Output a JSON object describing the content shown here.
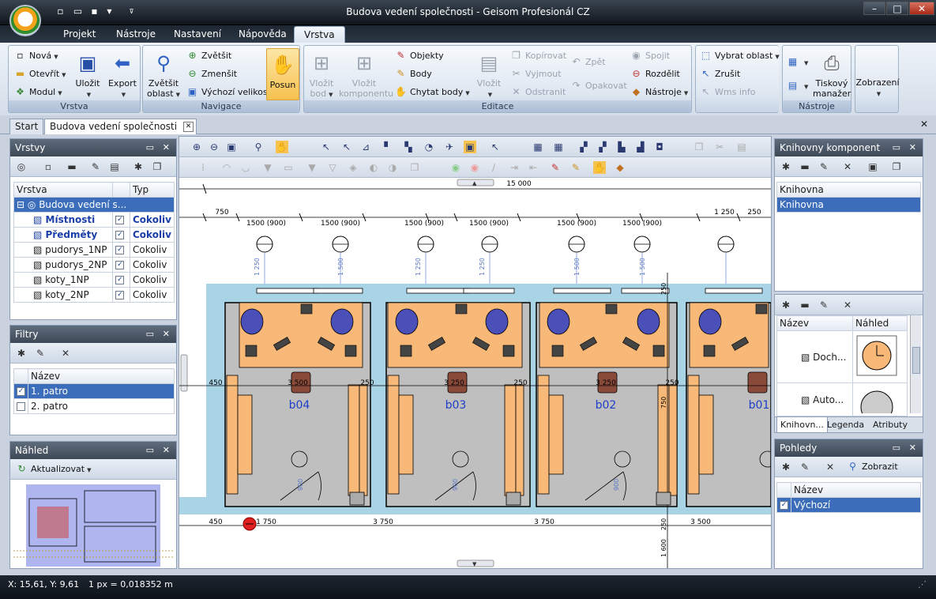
{
  "window": {
    "title": "Budova vedení společnosti - Geisom Profesionál CZ"
  },
  "ribbon_tabs": [
    "Projekt",
    "Nástroje",
    "Nastavení",
    "Nápověda",
    "Vrstva"
  ],
  "ribbon": {
    "vrstva_group": {
      "label": "Vrstva",
      "nova": "Nová",
      "otevrit": "Otevřít",
      "modul": "Modul",
      "ulozit": "Uložit",
      "export": "Export"
    },
    "navigace_group": {
      "label": "Navigace",
      "zvetsit_oblast_1": "Zvětšit",
      "zvetsit_oblast_2": "oblast",
      "zvetsit": "Zvětšit",
      "zmensit": "Zmenšit",
      "vychozi": "Výchozí velikost",
      "posun": "Posun"
    },
    "editace_group": {
      "label": "Editace",
      "vlozit_bod_1": "Vložit",
      "vlozit_bod_2": "bod",
      "vlozit_komp_1": "Vložit",
      "vlozit_komp_2": "komponentu",
      "objekty": "Objekty",
      "body": "Body",
      "chytat_body": "Chytat body",
      "vlozit": "Vložit",
      "kopirovat": "Kopírovat",
      "vyjmout": "Vyjmout",
      "odstranit": "Odstranit",
      "zpet": "Zpět",
      "opakovat": "Opakovat",
      "spojit": "Spojit",
      "rozdelit": "Rozdělit",
      "nastroje": "Nástroje",
      "vybrat_oblast": "Vybrat oblast",
      "zrusit": "Zrušit",
      "wms_info": "Wms info"
    },
    "nastroje_group": {
      "label": "Nástroje",
      "tiskovy_1": "Tiskový",
      "tiskovy_2": "manažer",
      "zobrazeni": "Zobrazení"
    }
  },
  "doc_tabs": {
    "start": "Start",
    "active": "Budova vedení společnosti"
  },
  "vrstvy": {
    "title": "Vrstvy",
    "col_vrstva": "Vrstva",
    "col_typ": "Typ",
    "root": "Budova vedení s...",
    "rows": [
      {
        "name": "Místnosti",
        "typ": "Cokoliv",
        "checked": "✓",
        "bold": true
      },
      {
        "name": "Předměty",
        "typ": "Cokoliv",
        "checked": "✓",
        "bold": true
      },
      {
        "name": "pudorys_1NP",
        "typ": "Cokoliv",
        "checked": "✓",
        "bold": false
      },
      {
        "name": "pudorys_2NP",
        "typ": "Cokoliv",
        "checked": "✓",
        "bold": false
      },
      {
        "name": "koty_1NP",
        "typ": "Cokoliv",
        "checked": "✓",
        "bold": false
      },
      {
        "name": "koty_2NP",
        "typ": "Cokoliv",
        "checked": "✓",
        "bold": false
      }
    ]
  },
  "filtry": {
    "title": "Filtry",
    "col_nazev": "Název",
    "rows": [
      {
        "name": "1. patro",
        "checked": "✓"
      },
      {
        "name": "2. patro",
        "checked": ""
      }
    ]
  },
  "nahled": {
    "title": "Náhled",
    "aktualizovat": "Aktualizovat"
  },
  "knihovny": {
    "title": "Knihovny komponent",
    "col": "Knihovna",
    "rows": [
      "Knihovna"
    ],
    "lower_col_nazev": "Název",
    "lower_col_nahled": "Náhled",
    "items": [
      "Doch...",
      "Auto..."
    ],
    "tabs": [
      "Knihovn...",
      "Legenda",
      "Atributy"
    ]
  },
  "pohledy": {
    "title": "Pohledy",
    "zobrazit": "Zobrazit",
    "col_nazev": "Název",
    "rows": [
      {
        "name": "Výchozí",
        "checked": "✓"
      }
    ]
  },
  "plan": {
    "overall": "15 000",
    "dims_left": "750",
    "dims_mid": [
      "1500 (900)",
      "1500 (900)",
      "1500 (900)",
      "1500 (900)",
      "1500 (900)",
      "1500 (900)"
    ],
    "dims_right": "1 250",
    "dims_right2": "250",
    "vert_dims": [
      "1 250",
      "1 500",
      "1 250",
      "1 250",
      "1 500",
      "1 500"
    ],
    "v750": "750",
    "v250": "250",
    "v1600": "1 600",
    "mid_row": [
      "450",
      "3 500",
      "250",
      "3 250",
      "250",
      "3 250",
      "250"
    ],
    "bottom_row": [
      "450",
      "1 750",
      "3 750",
      "3 750",
      "3 500"
    ],
    "rooms": [
      "b04",
      "b03",
      "b02",
      "b01"
    ],
    "v900": [
      "900",
      "900",
      "900"
    ],
    "v150": "150"
  },
  "status": {
    "coords": "X: 15,61, Y: 9,61",
    "scale": "1 px = 0,018352 m"
  }
}
